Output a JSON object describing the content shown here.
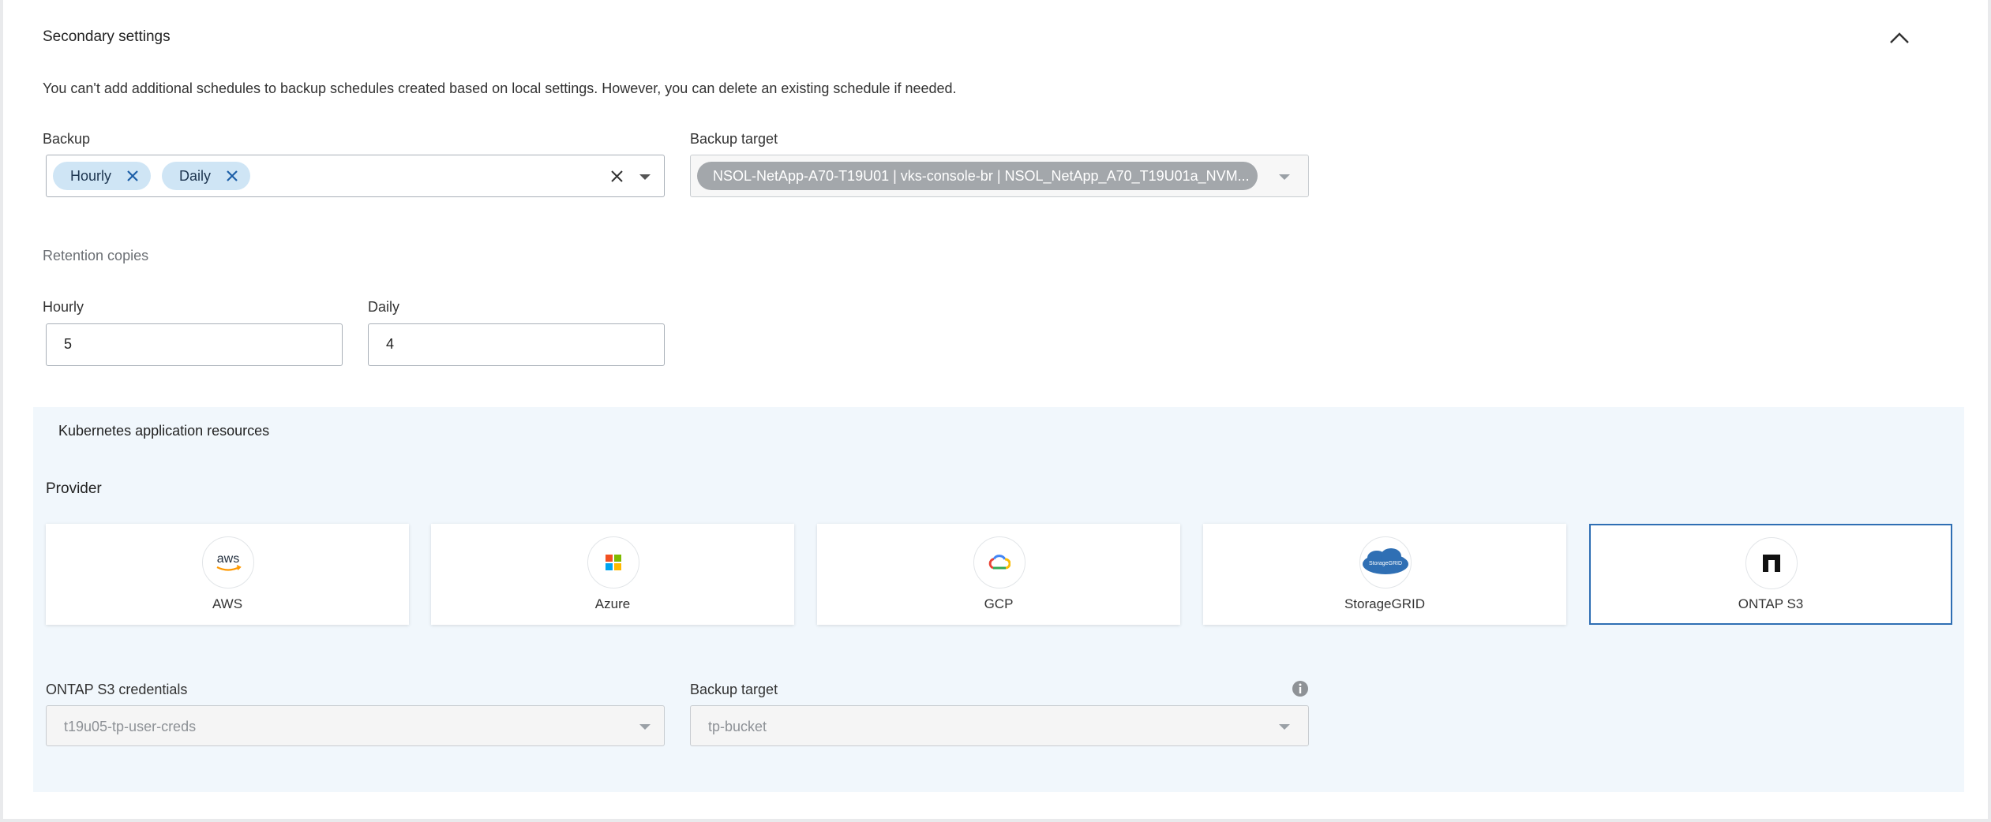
{
  "section": {
    "title": "Secondary settings",
    "note": "You can't add additional schedules to backup schedules created based on local settings. However, you can delete an existing schedule if needed."
  },
  "backup": {
    "label": "Backup",
    "chips": [
      "Hourly",
      "Daily"
    ]
  },
  "backup_target_top": {
    "label": "Backup target",
    "value": "NSOL-NetApp-A70-T19U01 | vks-console-br | NSOL_NetApp_A70_T19U01a_NVM..."
  },
  "retention": {
    "heading": "Retention copies",
    "hourly_label": "Hourly",
    "hourly_value": "5",
    "daily_label": "Daily",
    "daily_value": "4"
  },
  "k8s": {
    "heading": "Kubernetes application resources",
    "provider_label": "Provider",
    "providers": [
      {
        "label": "AWS",
        "icon": "aws-logo"
      },
      {
        "label": "Azure",
        "icon": "azure-logo"
      },
      {
        "label": "GCP",
        "icon": "gcp-logo"
      },
      {
        "label": "StorageGRID",
        "icon": "storagegrid-logo"
      },
      {
        "label": "ONTAP S3",
        "icon": "ontap-logo"
      }
    ],
    "selected_provider": "ONTAP S3",
    "credentials_label": "ONTAP S3 credentials",
    "credentials_value": "t19u05-tp-user-creds",
    "backup_target_label": "Backup target",
    "backup_target_value": "tp-bucket"
  },
  "logo_text": {
    "aws": "aws",
    "storagegrid": "StorageGRID"
  },
  "colors": {
    "chip": "#cfe5f5",
    "selected_border": "#2f6fb4",
    "k8s_background": "#f1f7fc",
    "target_chip": "#a3a7ab"
  }
}
